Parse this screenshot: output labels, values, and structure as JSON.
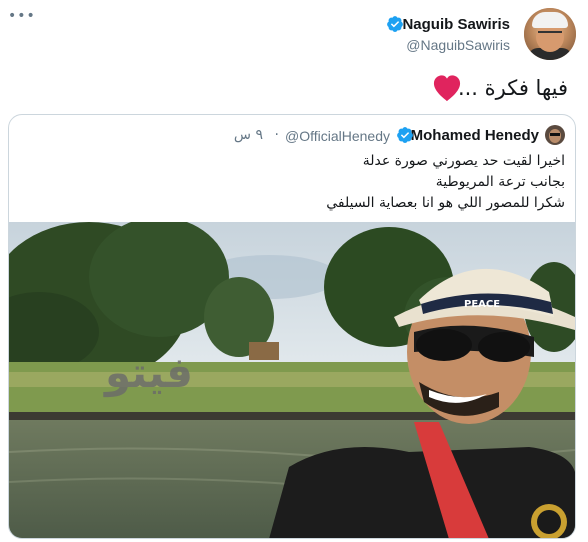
{
  "tweet": {
    "author_name": "Naguib Sawiris",
    "author_handle": "@NaguibSawiris",
    "text": "فيها فكرة ...",
    "emoji": "red-heart",
    "more_icon": "•••"
  },
  "quoted_tweet": {
    "author_name": "Mohamed Henedy",
    "author_handle": "@OfficialHenedy",
    "separator": "·",
    "time": "٩ س",
    "lines": [
      "اخيرا لقيت حد يصورني صورة عدلة",
      "بجانب ترعة المريوطية",
      "شكرا للمصور اللي هو انا بعصاية السيلفي"
    ],
    "photo": {
      "watermark": "فيتو",
      "hat_band_text": "PEACE"
    }
  },
  "colors": {
    "text": "#14171a",
    "secondary": "#657786",
    "verified": "#1da1f2",
    "heart": "#e0245e",
    "border": "#ccd6dd"
  }
}
